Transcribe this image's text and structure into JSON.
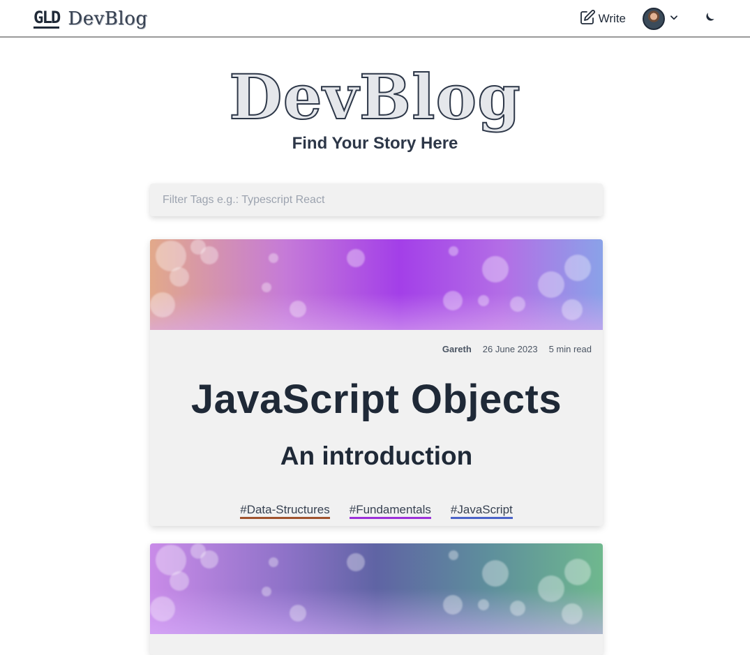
{
  "nav": {
    "logo_mark": "GLD",
    "logo_text": "DevBlog",
    "write_label": "Write"
  },
  "hero": {
    "title": "DevBlog",
    "subtitle": "Find Your Story Here"
  },
  "search": {
    "placeholder": "Filter Tags e.g.: Typescript React"
  },
  "posts": [
    {
      "author": "Gareth",
      "date": "26 June 2023",
      "read_time": "5 min read",
      "title": "JavaScript Objects",
      "subtitle": "An introduction",
      "tags": [
        {
          "label": "#Data-Structures",
          "color": "#a0522d"
        },
        {
          "label": "#Fundamentals",
          "color": "#9b30d9"
        },
        {
          "label": "#JavaScript",
          "color": "#4a62c9"
        }
      ]
    }
  ],
  "colors": {
    "text_dark": "#1f2937",
    "card_bg": "#f1f1f1",
    "nav_border": "#9a9a9a"
  },
  "icons": [
    "write-icon",
    "chevron-down-icon",
    "moon-icon"
  ]
}
